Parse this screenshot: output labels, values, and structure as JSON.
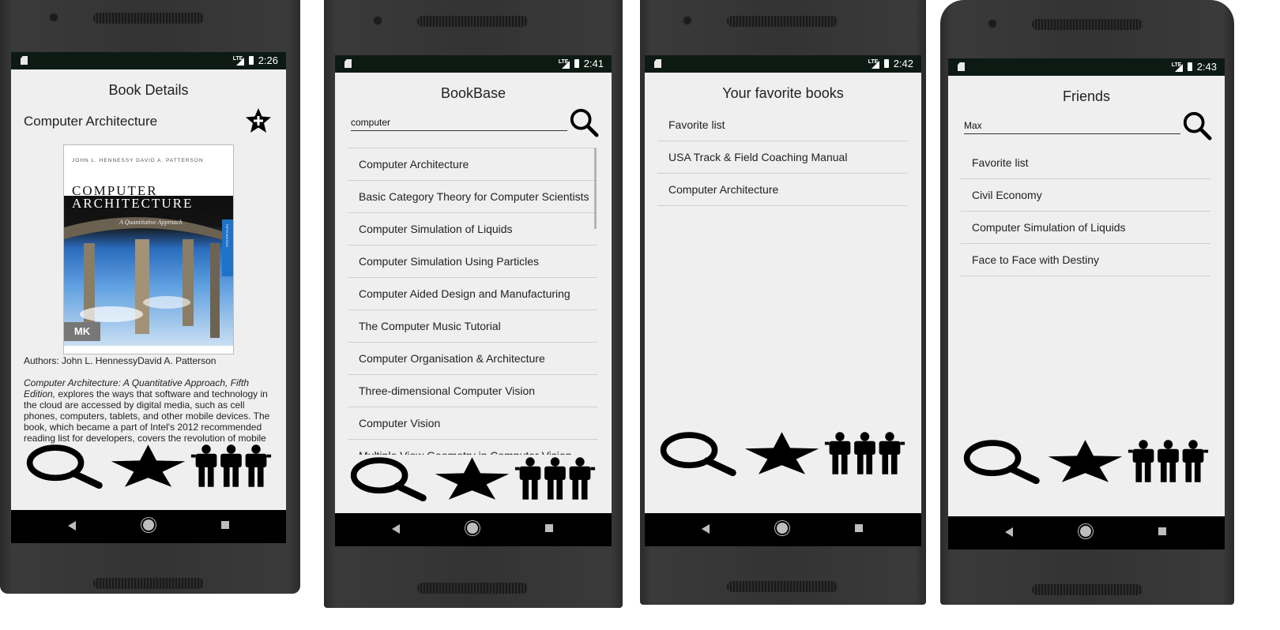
{
  "screens": [
    {
      "status_time": "2:26",
      "title": "Book Details",
      "book_title": "Computer Architecture",
      "favorite_icon": "star-add-icon",
      "cover": {
        "authors_line": "JOHN L. HENNESSY   DAVID A. PATTERSON",
        "title_line1": "COMPUTER",
        "title_line2": "ARCHITECTURE",
        "subtitle": "A Quantitative Approach",
        "edition_spine": "FIFTH EDITION",
        "publisher_logo": "MK"
      },
      "authors": "Authors: John L. HennessyDavid A. Patterson",
      "description_italic": "Computer Architecture: A Quantitative Approach, Fifth Edition,",
      "description_rest": " explores the ways that software and technology in the cloud are accessed by digital media, such as cell phones, computers, tablets, and other mobile devices. The book, which became a part of Intel's 2012 recommended reading list for developers, covers the revolution of mobile",
      "nav_icons": [
        "search-icon",
        "star-icon",
        "friends-icon"
      ]
    },
    {
      "status_time": "2:41",
      "title": "BookBase",
      "search": {
        "value": "computer",
        "placeholder": ""
      },
      "items": [
        "Computer Architecture",
        "Basic Category Theory for Computer Scientists",
        "Computer Simulation of Liquids",
        "Computer Simulation Using Particles",
        "Computer Aided Design and Manufacturing",
        "The Computer Music Tutorial",
        "Computer Organisation & Architecture",
        "Three-dimensional Computer Vision",
        "Computer Vision",
        "Multiple View Geometry in Computer Vision"
      ],
      "nav_icons": [
        "search-icon",
        "star-icon",
        "friends-icon"
      ]
    },
    {
      "status_time": "2:42",
      "title": "Your favorite books",
      "items": [
        "Favorite list",
        "USA Track & Field Coaching Manual",
        "Computer Architecture"
      ],
      "nav_icons": [
        "search-icon",
        "star-icon",
        "friends-icon"
      ]
    },
    {
      "status_time": "2:43",
      "title": "Friends",
      "search": {
        "value": "Max",
        "placeholder": ""
      },
      "items": [
        "Favorite list",
        "Civil Economy",
        "Computer Simulation of Liquids",
        "Face to Face with Destiny"
      ],
      "nav_icons": [
        "search-icon",
        "star-icon",
        "friends-icon"
      ]
    }
  ],
  "system_nav": {
    "back": "back-icon",
    "home": "home-icon",
    "recents": "recents-icon"
  },
  "colors": {
    "screen_bg": "#efefef",
    "status_bar": "#0d1a14",
    "phone_frame": "#333333",
    "cover_blue": "#1e73c8"
  }
}
